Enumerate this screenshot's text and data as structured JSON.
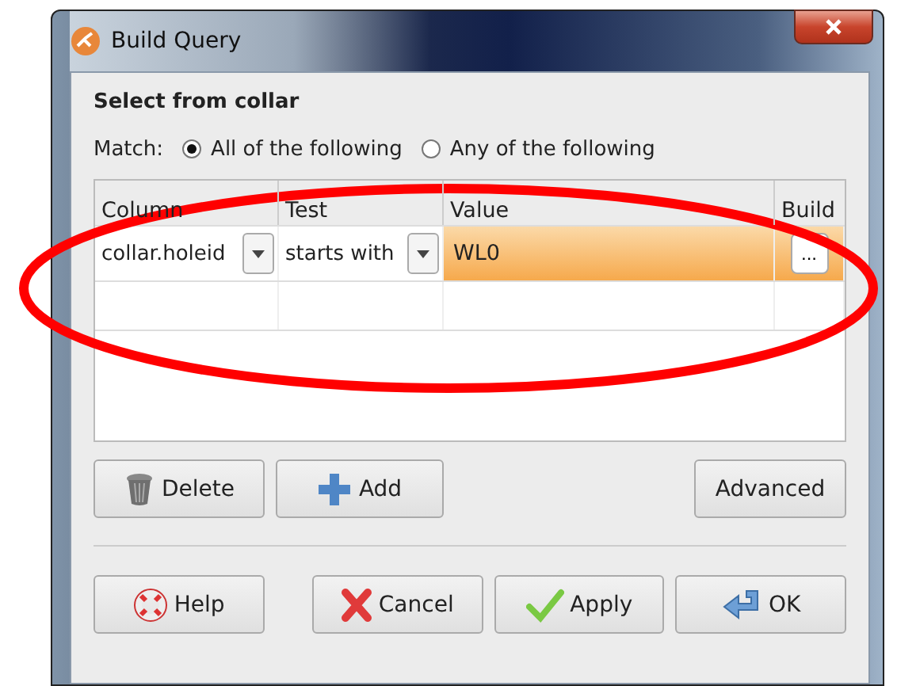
{
  "window": {
    "title": "Build Query"
  },
  "heading": "Select from collar",
  "match": {
    "label": "Match:",
    "options": [
      {
        "label": "All of the following",
        "selected": true
      },
      {
        "label": "Any of the following",
        "selected": false
      }
    ]
  },
  "table": {
    "columns": [
      "Column",
      "Test",
      "Value",
      "Build"
    ],
    "rows": [
      {
        "column": "collar.holeid",
        "test": "starts with",
        "value": "WL0",
        "build": "...",
        "selected": true
      }
    ]
  },
  "row_buttons": [
    "Delete",
    "Add",
    "Advanced"
  ],
  "dialog_buttons": [
    "Help",
    "Cancel",
    "Apply",
    "OK"
  ],
  "annotations": [
    {
      "kind": "ellipse"
    }
  ]
}
